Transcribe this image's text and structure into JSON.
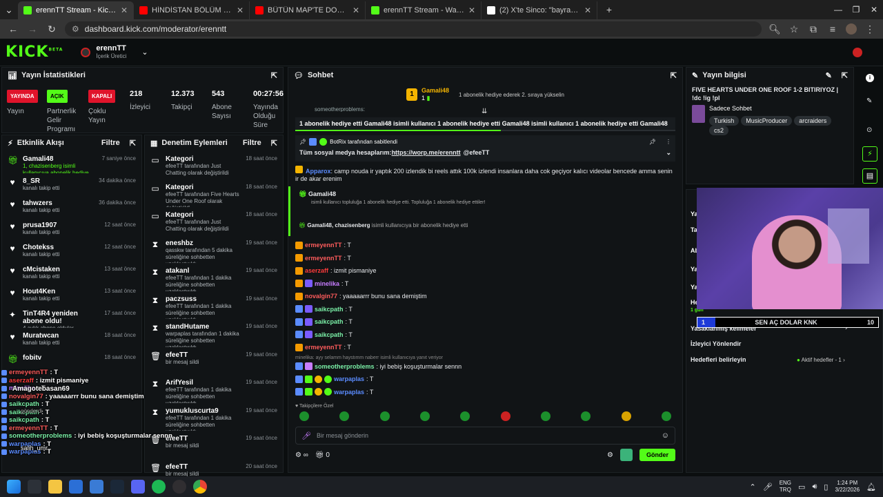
{
  "browser": {
    "tabs": [
      {
        "title": "erennTT Stream - Kick Dashboard",
        "color": "#53fc18",
        "active": true
      },
      {
        "title": "HİNDİSTAN BÖLÜM 2: VARANASİ",
        "color": "#ff0000",
        "active": false
      },
      {
        "title": "BÜTÜN MAP'TE DOLAŞTIK! w/Se",
        "color": "#ff0000",
        "active": false
      },
      {
        "title": "erennTT Stream - Watch Live on",
        "color": "#53fc18",
        "active": false
      },
      {
        "title": "(2) X'te Sinco: \"bayramda 5tl ha",
        "color": "#ffffff",
        "active": false
      }
    ],
    "url": "dashboard.kick.com/moderator/erenntt"
  },
  "header": {
    "logo": "KICK",
    "logo_beta": "BETA",
    "channel": "erennTT",
    "role": "İçerik Üretici"
  },
  "stats": {
    "title": "Yayın İstatistikleri",
    "status_badge": "YAYINDA",
    "status_label": "Yayın",
    "partner_badge": "AÇIK",
    "partner_label": "Partnerlik Gelir Programı",
    "multi_badge": "KAPALI",
    "multi_label": "Çoklu Yayın",
    "viewers_value": "218",
    "viewers_label": "İzleyici",
    "followers_value": "12.373",
    "followers_label": "Takipçi",
    "subs_value": "543",
    "subs_label": "Abone Sayısı",
    "uptime_value": "00:27:56",
    "uptime_label": "Yayında Olduğu Süre"
  },
  "activity": {
    "title": "Etkinlik Akışı",
    "filter": "Filtre",
    "items": [
      {
        "icon": "gift",
        "name": "Gamali48",
        "sub": "1, chazisenberg isimli kullanıcıya abonelik hediye etti.",
        "time": "7 saniye önce"
      },
      {
        "icon": "heart",
        "name": "8_SR",
        "sub": "kanalı takip etti",
        "time": "34 dakika önce"
      },
      {
        "icon": "heart",
        "name": "tahwzers",
        "sub": "kanalı takip etti",
        "time": "36 dakika önce"
      },
      {
        "icon": "heart",
        "name": "prusa1907",
        "sub": "kanalı takip etti",
        "time": "12 saat önce"
      },
      {
        "icon": "heart",
        "name": "Chotekss",
        "sub": "kanalı takip etti",
        "time": "12 saat önce"
      },
      {
        "icon": "heart",
        "name": "cMcistaken",
        "sub": "kanalı takip etti",
        "time": "13 saat önce"
      },
      {
        "icon": "heart",
        "name": "Hout4Ken",
        "sub": "kanalı takip etti",
        "time": "13 saat önce"
      },
      {
        "icon": "star",
        "name": "TinT4R4 yeniden abone oldu!",
        "sub": "4 aylık abone oldular",
        "time": "17 saat önce"
      },
      {
        "icon": "heart",
        "name": "Muratwcan",
        "sub": "kanalı takip etti",
        "time": "18 saat önce"
      },
      {
        "icon": "gift",
        "name": "fobitv",
        "sub": "",
        "time": "18 saat önce"
      }
    ]
  },
  "moderation": {
    "title": "Denetim Eylemleri",
    "filter": "Filtre",
    "items": [
      {
        "icon": "cat",
        "name": "Kategori",
        "sub": "efeeTT tarafından Just Chatting olarak değiştirildi",
        "time": "18 saat önce"
      },
      {
        "icon": "cat",
        "name": "Kategori",
        "sub": "efeeTT tarafından Five Hearts Under One Roof olarak değiştirildi",
        "time": "18 saat önce"
      },
      {
        "icon": "cat",
        "name": "Kategori",
        "sub": "efeeTT tarafından Just Chatting olarak değiştirildi",
        "time": "18 saat önce"
      },
      {
        "icon": "timer",
        "name": "eneshbz",
        "sub": "qasskw tarafından 5 dakika süreliğine sohbetten uzaklaştırıldı",
        "time": "19 saat önce"
      },
      {
        "icon": "timer",
        "name": "atakanl",
        "sub": "efeeTT tarafından 1 dakika süreliğine sohbetten uzaklaştırıldı",
        "time": "19 saat önce"
      },
      {
        "icon": "timer",
        "name": "paczsuss",
        "sub": "efeeTT tarafından 1 dakika süreliğine sohbetten uzaklaştırıldı",
        "time": "19 saat önce"
      },
      {
        "icon": "timer",
        "name": "standHutame",
        "sub": "warpaplas tarafından 1 dakika süreliğine sohbetten uzaklaştırıldı",
        "time": "19 saat önce"
      },
      {
        "icon": "trash",
        "name": "efeeTT",
        "sub": "bir mesaj sildi",
        "time": "19 saat önce"
      },
      {
        "icon": "timer",
        "name": "ArifYesil",
        "sub": "efeeTT tarafından 1 dakika süreliğine sohbetten uzaklaştırıldı",
        "time": "19 saat önce"
      },
      {
        "icon": "timer",
        "name": "yumukluscurta9",
        "sub": "efeeTT tarafından 1 dakika süreliğine sohbetten uzaklaştırıldı",
        "time": "19 saat önce"
      },
      {
        "icon": "trash",
        "name": "efeeTT",
        "sub": "bir mesaj sildi",
        "time": "19 saat önce"
      },
      {
        "icon": "trash",
        "name": "efeeTT",
        "sub": "bir mesaj sildi",
        "time": "20 saat önce"
      }
    ]
  },
  "chat": {
    "title": "Sohbet",
    "top_gifter": "Gamali48",
    "top_gifter_count": "1",
    "top_gifter_hint": "1 abonelik hediye ederek 2. sıraya yükselin",
    "ticker": "1 abonelik hediye etti  Gamali48 isimli kullanıcı 1 abonelik hediye etti  Gamali48 isimli kullanıcı 1 abonelik hediye etti  Gamali48",
    "ticker_top": "someotherproblems:",
    "pinned_by": "BotRix tarafından sabitlendi",
    "pinned_text": "Tüm sosyal medya hesaplarım: ",
    "pinned_link": "https://worp.me/erenntt",
    "pinned_mention": "@efeeTT",
    "messages": [
      {
        "user": "Apparox",
        "color": "#5b8cff",
        "text": ": camp nouda ir yaptık 200 izlendik bi reels attık 100k izlendi insanlara daha cok geçiyor kalıcı videolar bencede amma senin ir de akar erenim"
      },
      {
        "user": "ermeyennTT",
        "color": "#ff5c5c",
        "text": ": T"
      },
      {
        "user": "ermeyennTT",
        "color": "#ff5c5c",
        "text": ": T"
      },
      {
        "user": "aserzaff",
        "color": "#ff3b3b",
        "text": ": izmit pismaniye"
      },
      {
        "user": "minelika",
        "color": "#c77dff",
        "text": ": T"
      },
      {
        "user": "novalgin77",
        "color": "#ff5c5c",
        "text": ": yaaaaarrr bunu sana demiştim"
      },
      {
        "user": "saikcpath",
        "color": "#7bf1a8",
        "text": ": T"
      },
      {
        "user": "saikcpath",
        "color": "#7bf1a8",
        "text": ": T"
      },
      {
        "user": "saikcpath",
        "color": "#7bf1a8",
        "text": ": T"
      },
      {
        "user": "ermeyennTT",
        "color": "#ff5c5c",
        "text": ": T"
      }
    ],
    "gift_event_user": "Gamali48",
    "gift_event_text": "isimli kullanıcı topluluğa 1 abonelik hediye etti. Topluluğa 1 abonelik hediye ettiler!",
    "gift_event2": "Gamali48, chazisenberg",
    "gift_event2_text": " isimli kullanıcıya bir abonelik hediye etti",
    "reply_hint": "minelika: ayy selamm haystımm naberr isimli kullanıcıya yanıt veriyor",
    "reply_user": "someotherproblems",
    "reply_text": ": iyi bebiş koşuşturmalar sennn",
    "last1_user": "warpaplas",
    "last1_text": ": T",
    "last2_user": "warpaplas",
    "last2_text": ": T",
    "emote_section": "Takipçilere Özel",
    "input_placeholder": "Bir mesaj gönderin",
    "send_label": "Gönder",
    "footer_count": "0"
  },
  "stream_info": {
    "title": "Yayın bilgisi",
    "stream_title": "FIVE HEARTS UNDER ONE ROOF 1-2 BITIRIYOZ | !dc !ig !pl",
    "category": "Sadece Sohbet",
    "tags": [
      "Turkish",
      "MusicProducer",
      "arcraiders",
      "cs2"
    ]
  },
  "side_menu": {
    "viewer_redirect": "İzleyici Yönlendir",
    "goals": "Hedefleri belirleyin",
    "active_goals": "Aktif hedefler - 1",
    "blocked_words": "Yasaklanmış kelimeler",
    "goal_bar_start": "1",
    "goal_bar_text": "SEN AÇ DOLAR KNK",
    "goal_bar_end": "10",
    "goal_progress": 0.1,
    "partial_labels": [
      "Ya",
      "Tal",
      "Ab",
      "Ya",
      "Ya",
      "He",
      "1 gün"
    ]
  },
  "overlay_chat": [
    {
      "user": "ermeyennTT",
      "color": "#ff5c5c",
      "text": ": T"
    },
    {
      "user": "aserzaff",
      "color": "#ff3b3b",
      "text": ": izmit pismaniye"
    },
    {
      "user": "minelika",
      "color": "#c77dff",
      "text": ": T"
    },
    {
      "user": "novalgin77",
      "color": "#ff5c5c",
      "text": ": yaaaaarrr bunu sana demiştim"
    },
    {
      "user": "saikcpath",
      "color": "#7bf1a8",
      "text": ": T"
    },
    {
      "user": "saikcpath",
      "color": "#7bf1a8",
      "text": ": T"
    },
    {
      "user": "saikcpath",
      "color": "#7bf1a8",
      "text": ": T"
    },
    {
      "user": "ermeyennTT",
      "color": "#ff5c5c",
      "text": ": T"
    },
    {
      "user": "someotherproblems",
      "color": "#7bf1a8",
      "text": ": iyi bebiş koşuşturmalar sennn"
    },
    {
      "user": "warpaplas",
      "color": "#5b8cff",
      "text": ": T"
    },
    {
      "user": "warpaplas",
      "color": "#5b8cff",
      "text": ": T"
    }
  ],
  "overlay_extra": {
    "amagote": "Amagotebasan69",
    "gonderdi": "gönderdi",
    "salih": "salih_umr"
  },
  "taskbar": {
    "lang": "ENG",
    "lang2": "TRQ",
    "time": "1:24 PM",
    "date": "3/22/2026"
  }
}
